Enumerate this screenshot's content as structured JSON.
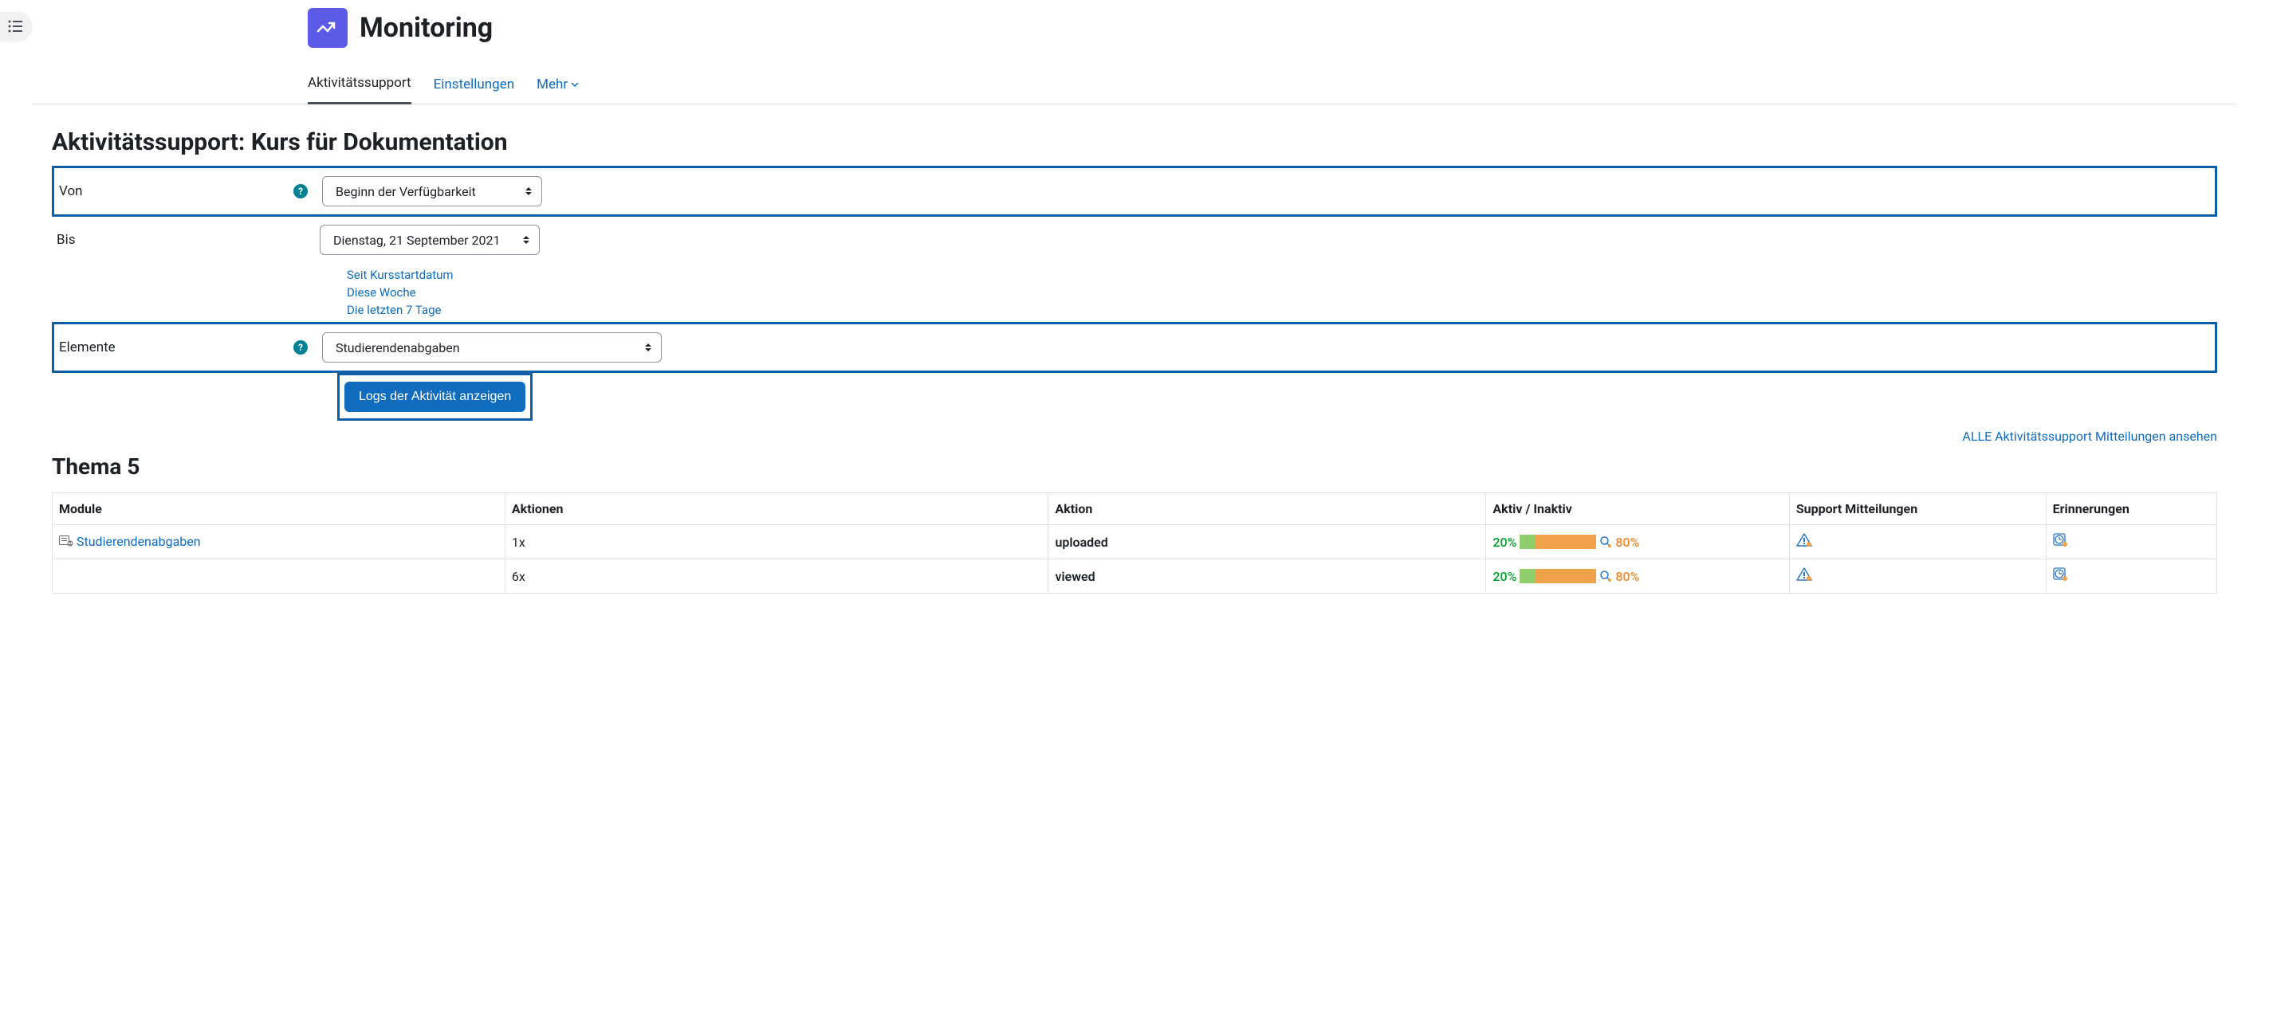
{
  "header": {
    "title": "Monitoring"
  },
  "tabs": [
    {
      "label": "Aktivitätssupport",
      "active": true
    },
    {
      "label": "Einstellungen",
      "active": false
    },
    {
      "label": "Mehr",
      "active": false,
      "dropdown": true
    }
  ],
  "form": {
    "heading": "Aktivitätssupport: Kurs für Dokumentation",
    "von": {
      "label": "Von",
      "value": "Beginn der Verfügbarkeit"
    },
    "bis": {
      "label": "Bis",
      "value": "Dienstag, 21 September 2021"
    },
    "quicklinks": [
      "Seit Kursstartdatum",
      "Diese Woche",
      "Die letzten 7 Tage"
    ],
    "elemente": {
      "label": "Elemente",
      "value": "Studierendenabgaben"
    },
    "submit": "Logs der Aktivität anzeigen"
  },
  "all_link": "ALLE Aktivitätssupport Mitteilungen ansehen",
  "section": {
    "title": "Thema 5",
    "columns": {
      "module": "Module",
      "aktionen": "Aktionen",
      "aktion": "Aktion",
      "aktiv": "Aktiv / Inaktiv",
      "support": "Support Mitteilungen",
      "erinnerungen": "Erinnerungen"
    },
    "rows": [
      {
        "module": "Studierendenabgaben",
        "aktionen": "1x",
        "aktion": "uploaded",
        "active_pct": "20%",
        "inactive_pct": "80%",
        "bar_green": 20,
        "bar_orange": 80
      },
      {
        "module": "",
        "aktionen": "6x",
        "aktion": "viewed",
        "active_pct": "20%",
        "inactive_pct": "80%",
        "bar_green": 20,
        "bar_orange": 80
      }
    ]
  }
}
